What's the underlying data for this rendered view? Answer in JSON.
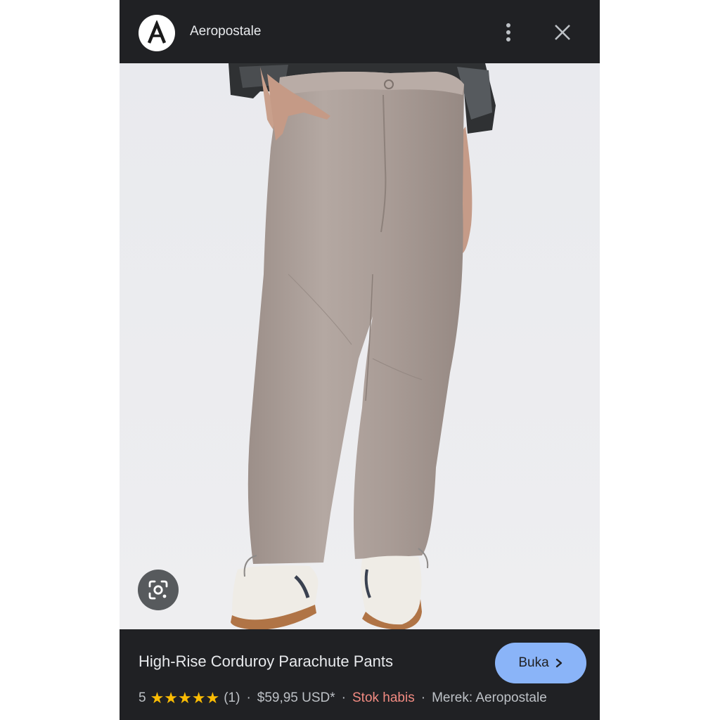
{
  "header": {
    "brand_initial": "A",
    "brand_name": "Aeropostale",
    "more_icon": "more-vert-icon",
    "close_icon": "close-icon"
  },
  "image": {
    "lens_icon": "google-lens-icon"
  },
  "product": {
    "title": "High-Rise Corduroy Parachute Pants",
    "open_label": "Buka",
    "rating": "5",
    "stars": "★★★★★",
    "review_count": "(1)",
    "price": "$59,95 USD*",
    "stock_status": "Stok habis",
    "brand": "Merek: Aeropostale",
    "separator": "·"
  },
  "colors": {
    "panel_bg": "#202124",
    "button_accent": "#8ab4f8",
    "star_color": "#fbbc04",
    "out_of_stock": "#f28b82"
  }
}
